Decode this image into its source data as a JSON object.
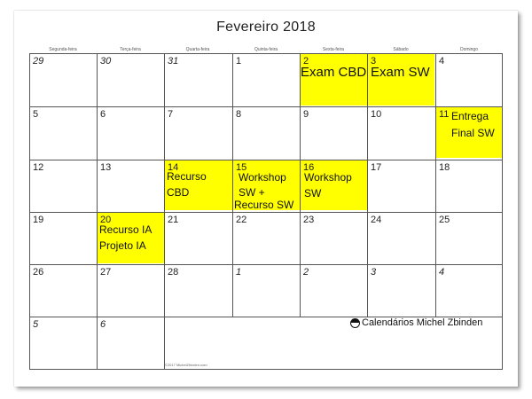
{
  "title": "Fevereiro 2018",
  "weekdays": [
    "Segunda-feira",
    "Terça-feira",
    "Quarta-feira",
    "Quinta-feira",
    "Sexta-feira",
    "Sábado",
    "Domingo"
  ],
  "weeks": [
    [
      "29",
      "30",
      "31",
      "1",
      "2",
      "3",
      "4"
    ],
    [
      "5",
      "6",
      "7",
      "8",
      "9",
      "10",
      "11"
    ],
    [
      "12",
      "13",
      "14",
      "15",
      "16",
      "17",
      "18"
    ],
    [
      "19",
      "20",
      "21",
      "22",
      "23",
      "24",
      "25"
    ],
    [
      "26",
      "27",
      "28",
      "1",
      "2",
      "3",
      "4"
    ],
    [
      "5",
      "6",
      "",
      "",
      "",
      "",
      ""
    ]
  ],
  "notes": {
    "d2": "Exam CBD",
    "d3": "Exam SW",
    "d11_line1": "Entrega",
    "d11_line2": "Final SW",
    "d14_line1": "Recurso",
    "d14_line2": "CBD",
    "d15_line1": "Workshop",
    "d15_line2": "SW   +",
    "d15_line3": "Recurso SW",
    "d16_line1": "Workshop",
    "d16_line2": "SW",
    "d20_line1": "Recurso IA",
    "d20_line2": "Projeto IA"
  },
  "highlight_color": "#ffff00",
  "brand": "Calendários Michel Zbinden",
  "brand_icon": "logo-icon",
  "copyright": "©2017 MichelZbinden.com"
}
